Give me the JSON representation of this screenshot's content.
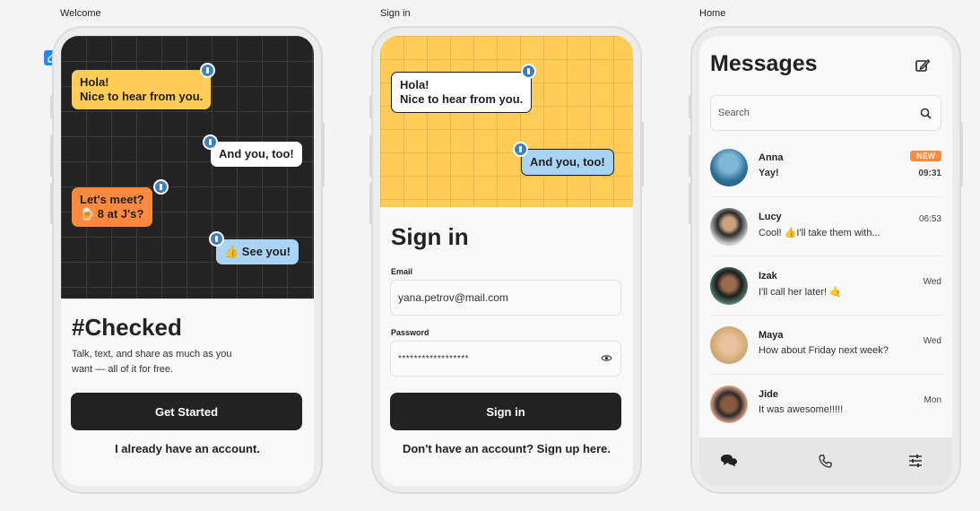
{
  "labels": {
    "welcome": "Welcome",
    "signin": "Sign in",
    "home": "Home"
  },
  "welcome": {
    "bubbles": [
      "Hola!\nNice to hear from you.",
      "And you, too!",
      "Let's meet?\n🍺 8 at J's?",
      "👍 See you!"
    ],
    "title": "#Checked",
    "subtitle": "Talk, text, and share as much as you want — all of it for free.",
    "primary_button": "Get Started",
    "secondary_link": "I already have an account."
  },
  "signin": {
    "bubbles": [
      "Hola!\nNice to hear from you.",
      "And you, too!"
    ],
    "title": "Sign in",
    "email_label": "Email",
    "email_value": "yana.petrov@mail.com",
    "password_label": "Password",
    "password_value": "******************",
    "primary_button": "Sign in",
    "signup_link": "Don't have an account? Sign up here."
  },
  "home": {
    "title": "Messages",
    "search_placeholder": "Search",
    "new_badge": "NEW",
    "messages": [
      {
        "name": "Anna",
        "text": "Yay!",
        "time": "09:31"
      },
      {
        "name": "Lucy",
        "text": "Cool! 👍I'll take them with...",
        "time": "06:53"
      },
      {
        "name": "Izak",
        "text": "I'll call her later! 🤙",
        "time": "Wed"
      },
      {
        "name": "Maya",
        "text": "How about Friday next week?",
        "time": "Wed"
      },
      {
        "name": "Jide",
        "text": "It was awesome!!!!!",
        "time": "Mon"
      }
    ]
  },
  "colors": {
    "dark": "#222222",
    "yellow": "#ffcd57",
    "orange": "#ff8a3d",
    "blue": "#a9d4f5",
    "pin": "#3d7fc0"
  },
  "icons": [
    "home-icon",
    "pin-icon",
    "compose-icon",
    "search-icon",
    "eye-icon",
    "chat-icon",
    "phone-icon",
    "sliders-icon"
  ]
}
